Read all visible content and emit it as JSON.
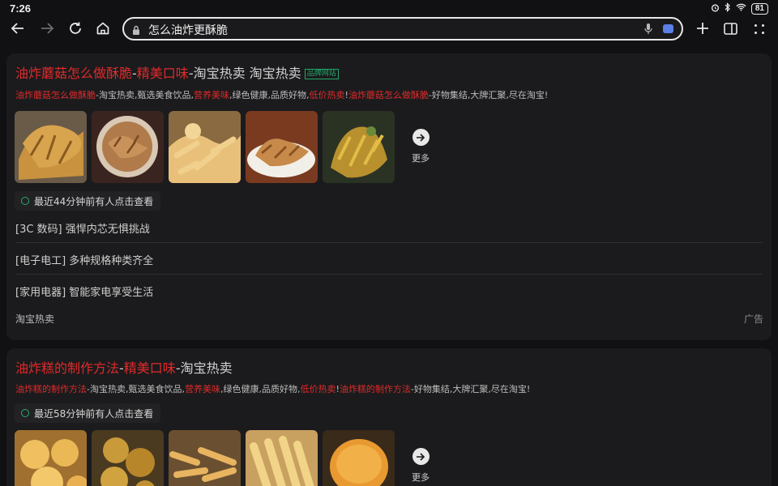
{
  "status": {
    "time": "7:26",
    "battery": "81"
  },
  "browser": {
    "query": "怎么油炸更酥脆"
  },
  "results": [
    {
      "title_parts": [
        {
          "text": "油炸蘑菇怎么做酥脆",
          "hl": true
        },
        {
          "text": "-",
          "hl": false
        },
        {
          "text": "精美口味",
          "hl": true
        },
        {
          "text": "-淘宝热卖 淘宝热卖",
          "hl": false
        }
      ],
      "badge": "品牌网站",
      "desc_parts": [
        {
          "text": "油炸蘑菇怎么做酥脆",
          "hl": true
        },
        {
          "text": "-淘宝热卖,甄选美食饮品,",
          "hl": false
        },
        {
          "text": "营养美味",
          "hl": true
        },
        {
          "text": ",绿色健康,品质好物,",
          "hl": false
        },
        {
          "text": "低价热卖",
          "hl": true
        },
        {
          "text": "!",
          "hl": false
        },
        {
          "text": "油炸蘑菇怎么做酥脆",
          "hl": true
        },
        {
          "text": "-好物集结,大牌汇聚,尽在淘宝!",
          "hl": false
        }
      ],
      "more_label": "更多",
      "recent": "最近44分钟前有人点击查看",
      "links": [
        "[3C 数码] 强悍内芯无惧挑战",
        "[电子电工] 多种规格种类齐全",
        "[家用电器] 智能家电享受生活"
      ],
      "source": "淘宝热卖",
      "ad_label": "广告"
    },
    {
      "title_parts": [
        {
          "text": "油炸糕的制作方法",
          "hl": true
        },
        {
          "text": "-",
          "hl": false
        },
        {
          "text": "精美口味",
          "hl": true
        },
        {
          "text": "-淘宝热卖",
          "hl": false
        }
      ],
      "desc_parts": [
        {
          "text": "油炸糕的制作方法",
          "hl": true
        },
        {
          "text": "-淘宝热卖,甄选美食饮品,",
          "hl": false
        },
        {
          "text": "营养美味",
          "hl": true
        },
        {
          "text": ",绿色健康,品质好物,",
          "hl": false
        },
        {
          "text": "低价热卖",
          "hl": true
        },
        {
          "text": "!",
          "hl": false
        },
        {
          "text": "油炸糕的制作方法",
          "hl": true
        },
        {
          "text": "-好物集结,大牌汇聚,尽在淘宝!",
          "hl": false
        }
      ],
      "recent": "最近58分钟前有人点击查看",
      "more_label": "更多"
    }
  ],
  "colors": {
    "highlight": "#e02a2a",
    "accent_green": "#22a86a",
    "card_bg": "#1b1b1d",
    "page_bg": "#111113"
  }
}
